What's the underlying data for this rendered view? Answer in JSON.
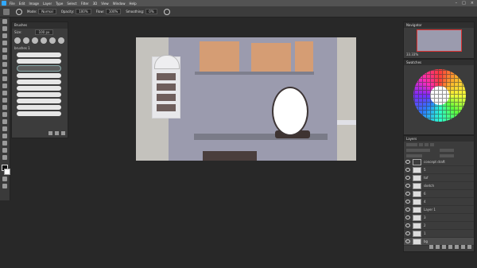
{
  "menubar": {
    "items": [
      "File",
      "Edit",
      "Image",
      "Layer",
      "Type",
      "Select",
      "Filter",
      "3D",
      "View",
      "Window",
      "Help"
    ]
  },
  "options": {
    "mode_label": "Mode:",
    "mode_value": "Normal",
    "opacity_label": "Opacity:",
    "opacity_value": "100%",
    "flow_label": "Flow:",
    "flow_value": "100%",
    "smoothing_label": "Smoothing:",
    "smoothing_value": "0%"
  },
  "brushes": {
    "title": "Brushes",
    "size_label": "Size:",
    "size_value": "100 px",
    "group_name": "brushes 1"
  },
  "navigator": {
    "title": "Navigator",
    "zoom": "33.33%"
  },
  "colors": {
    "title": "Swatches",
    "accent": "#31a8ff",
    "canvas_bg": "#9b9bae"
  },
  "layers": {
    "title": "Layers",
    "items": [
      {
        "name": "5",
        "type": "layer"
      },
      {
        "name": "tof",
        "type": "layer"
      },
      {
        "name": "sketch",
        "type": "layer"
      },
      {
        "name": "6",
        "type": "layer"
      },
      {
        "name": "4",
        "type": "layer"
      },
      {
        "name": "Layer 1",
        "type": "layer"
      },
      {
        "name": "3",
        "type": "layer"
      },
      {
        "name": "2",
        "type": "layer"
      },
      {
        "name": "1",
        "type": "layer"
      },
      {
        "name": "bg",
        "type": "layer"
      }
    ],
    "group_name": "concept draft"
  }
}
